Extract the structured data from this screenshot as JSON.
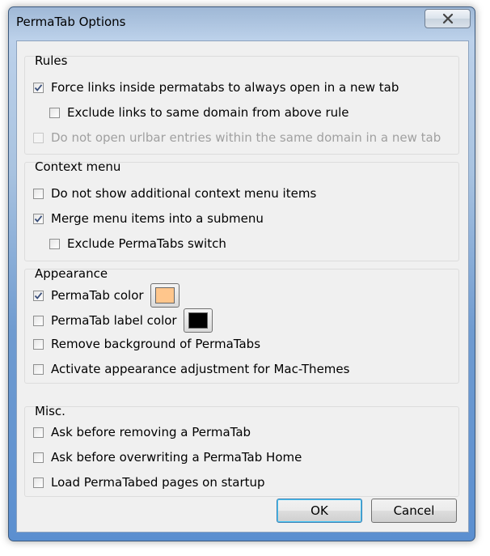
{
  "window": {
    "title": "PermaTab Options"
  },
  "groups": {
    "rules": {
      "title": "Rules",
      "items": [
        {
          "label": "Force links inside permatabs to always open in a new tab",
          "checked": true,
          "disabled": false
        },
        {
          "label": "Exclude links to same domain from above rule",
          "checked": false,
          "disabled": false
        },
        {
          "label": "Do not open urlbar entries within the same domain in a new tab",
          "checked": false,
          "disabled": true
        }
      ]
    },
    "context": {
      "title": "Context menu",
      "items": [
        {
          "label": "Do not show additional context menu items",
          "checked": false
        },
        {
          "label": "Merge menu items into a submenu",
          "checked": true
        },
        {
          "label": "Exclude PermaTabs switch",
          "checked": false
        }
      ]
    },
    "appearance": {
      "title": "Appearance",
      "items": [
        {
          "label": "PermaTab color",
          "checked": true,
          "color": "#ffc68c"
        },
        {
          "label": "PermaTab label color",
          "checked": false,
          "color": "#000000"
        },
        {
          "label": "Remove background of PermaTabs",
          "checked": false
        },
        {
          "label": "Activate appearance adjustment for Mac-Themes",
          "checked": false
        }
      ]
    },
    "misc": {
      "title": "Misc.",
      "items": [
        {
          "label": "Ask before removing a PermaTab",
          "checked": false
        },
        {
          "label": "Ask before overwriting a PermaTab Home",
          "checked": false
        },
        {
          "label": "Load PermaTabed pages on startup",
          "checked": false
        }
      ]
    }
  },
  "buttons": {
    "ok": "OK",
    "cancel": "Cancel"
  }
}
